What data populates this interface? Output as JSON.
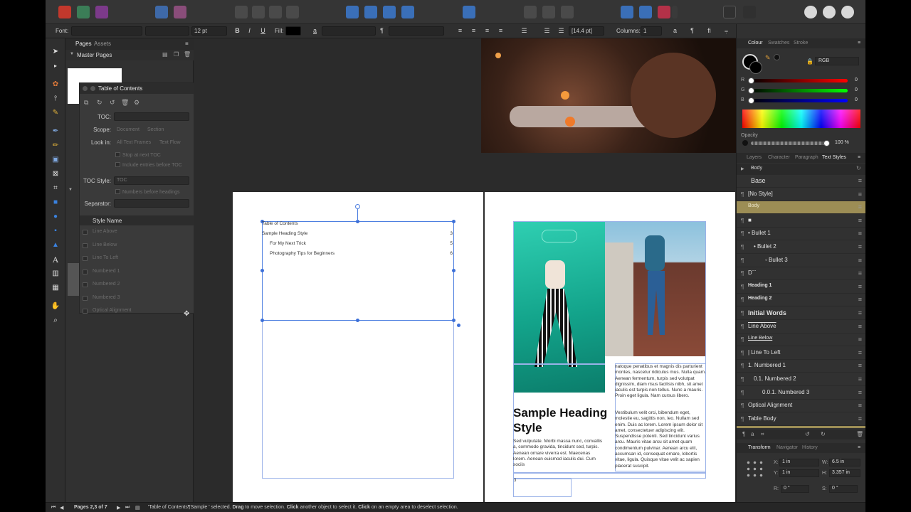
{
  "context": {
    "font_label": "Font:",
    "size_value": "12 pt",
    "bold": "B",
    "italic": "I",
    "underline": "U",
    "fill_label": "Fill:",
    "leading_value": "[14.4 pt]",
    "columns_label": "Columns:",
    "columns_value": "1"
  },
  "pages_panel": {
    "tabs": [
      "Pages",
      "Assets"
    ],
    "master_pages": "Master Pages"
  },
  "toc_panel": {
    "title": "Table of Contents",
    "toc_label": "TOC:",
    "scope_label": "Scope:",
    "scope_options": [
      "Document",
      "Section"
    ],
    "look_in_label": "Look in:",
    "look_in_options": [
      "All Text Frames",
      "Text Flow"
    ],
    "stop_at_next": "Stop at next TOC",
    "include_entries": "Include entries before TOC",
    "toc_style_label": "TOC Style:",
    "toc_style_value": "TOC",
    "numbers_before": "Numbers before headings",
    "separator_label": "Separator:",
    "col_style_name": "Style Name",
    "col_i": "i",
    "styles": [
      "Line Above",
      "Line Below",
      "Line To Left",
      "Numbered 1",
      "Numbered 2",
      "Numbered 3",
      "Optical Alignment"
    ]
  },
  "document": {
    "toc_entries": [
      {
        "text": "Table of Contents",
        "page": ""
      },
      {
        "text": "Sample Heading Style",
        "page": "3"
      },
      {
        "text": "For My Next Trick",
        "page": "5"
      },
      {
        "text": "Photography Tips for Beginners",
        "page": "6"
      }
    ],
    "heading": "Sample Heading Style",
    "body_left": "Sed vulputate. Morbi massa nunc, convallis a, commodo gravida, tincidunt sed, turpis. Aenean ornare viverra est. Maecenas lorem. Aenean euismod iaculis dui. Cum sociis",
    "body_right_1": "natoque penatibus et magnis dis parturient montes, nascetur ridiculus mus. Nulla quam. Aenean fermentum, turpis sed volutpat dignissim, diam risus facilisis nibh, sit amet iaculis est turpis non tellus. Nunc a mauris. Proin eget ligula. Nam cursus libero.",
    "body_right_2": "Vestibulum velit orci, bibendum eget, molestie eu, sagittis non, leo. Nullam sed enim. Duis ac lorem. Lorem ipsum dolor sit amet, consectetuer adipiscing elit. Suspendisse potenti. Sed tincidunt varius arcu. Mauris vitae arcu sit amet quam condimentum pulvinar. Aenean arcu elit, accumsan id, consequat ornare, lobortis vitae, ligula. Quisque vitae velit ac sapien placerat suscipit.",
    "page_number": "3"
  },
  "colour_panel": {
    "tabs": [
      "Colour",
      "Swatches",
      "Stroke"
    ],
    "mode": "RGB",
    "r_label": "R",
    "g_label": "G",
    "b_label": "B",
    "r_value": "0",
    "g_value": "0",
    "b_value": "0",
    "opacity_label": "Opacity",
    "opacity_value": "100 %",
    "opacity_fraction": 1.0
  },
  "styles_panel": {
    "tabs": [
      "Layers",
      "Character",
      "Paragraph",
      "Text Styles"
    ],
    "current": "Body",
    "items": [
      {
        "pil": "",
        "name": "Base"
      },
      {
        "pil": "¶",
        "name": "[No Style]"
      },
      {
        "pil": "",
        "name": "Body"
      },
      {
        "pil": "¶",
        "name": "■"
      },
      {
        "pil": "¶",
        "name": "•   Bullet 1"
      },
      {
        "pil": "¶",
        "name": "•   Bullet 2"
      },
      {
        "pil": "¶",
        "name": "◦   Bullet 3"
      },
      {
        "pil": "¶",
        "name": "D¨¨"
      },
      {
        "pil": "¶",
        "name": "Heading 1"
      },
      {
        "pil": "¶",
        "name": "Heading 2"
      },
      {
        "pil": "¶",
        "name": "Initial Words"
      },
      {
        "pil": "¶",
        "name": "Line Above"
      },
      {
        "pil": "¶",
        "name": "Line Below"
      },
      {
        "pil": "¶",
        "name": "|    Line To Left"
      },
      {
        "pil": "¶",
        "name": "1.   Numbered 1"
      },
      {
        "pil": "¶",
        "name": "0.1.     Numbered 2"
      },
      {
        "pil": "¶",
        "name": "0.0.1.      Numbered 3"
      },
      {
        "pil": "¶",
        "name": "Optical Alignment"
      },
      {
        "pil": "¶",
        "name": "Table Body"
      }
    ]
  },
  "transform_panel": {
    "tabs": [
      "Transform",
      "Navigator",
      "History"
    ],
    "x_label": "X:",
    "x_value": "1 in",
    "y_label": "Y:",
    "y_value": "1 in",
    "w_label": "W:",
    "w_value": "6.5 in",
    "h_label": "H:",
    "h_value": "3.357 in",
    "r_label": "R:",
    "r_value": "0 °",
    "s_label": "S:",
    "s_value": "0 °"
  },
  "status": {
    "pages": "Pages 2,3 of 7",
    "message_prefix": "'Table of Contents¶Sample ' selected.",
    "drag": "Drag",
    "drag_rest": "to move selection.",
    "click": "Click",
    "click_rest": "another object to select it.",
    "click2": "Click",
    "click2_rest": "on an empty area to deselect selection."
  },
  "colors": {
    "selection": "#4d7fe0",
    "style_highlight": "#9c8d55",
    "accent_red": "#d8313a"
  }
}
